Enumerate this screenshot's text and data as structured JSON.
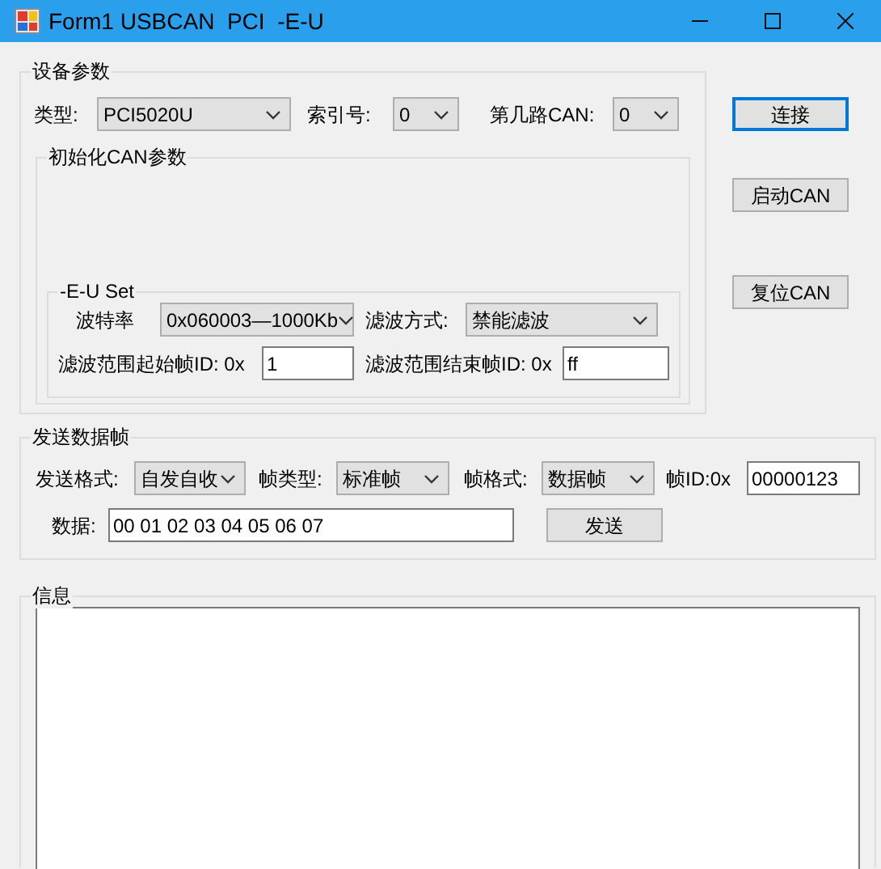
{
  "window": {
    "title": "Form1 USBCAN  PCI  -E-U"
  },
  "device_params": {
    "title": "设备参数",
    "fields": [
      {
        "label": "类型:",
        "value": "PCI5020U"
      },
      {
        "label": "索引号:",
        "value": "0"
      },
      {
        "label": "第几路CAN:",
        "value": "0"
      }
    ],
    "init_group": {
      "title": "初始化CAN参数",
      "eu_set": {
        "title": "-E-U Set",
        "row_1": [
          {
            "kind": "combo",
            "label": "波特率",
            "value": "0x060003—1000Kb"
          },
          {
            "kind": "combo",
            "label": "滤波方式:",
            "value": "禁能滤波"
          }
        ],
        "row_2": [
          {
            "kind": "input",
            "label": "滤波范围起始帧ID: 0x",
            "value": "1"
          },
          {
            "kind": "input",
            "label": "滤波范围结束帧ID: 0x",
            "value": "ff"
          }
        ]
      }
    }
  },
  "side_buttons": [
    {
      "label": "连接",
      "focused": true
    },
    {
      "label": "启动CAN",
      "focused": false
    },
    {
      "label": "复位CAN",
      "focused": false
    }
  ],
  "send_frame": {
    "title": "发送数据帧",
    "row_1": [
      {
        "kind": "combo",
        "label": "发送格式:",
        "value": "自发自收"
      },
      {
        "kind": "combo",
        "label": "帧类型:",
        "value": "标准帧"
      },
      {
        "kind": "combo",
        "label": "帧格式:",
        "value": "数据帧"
      },
      {
        "kind": "input",
        "label": "帧ID:0x",
        "value": "00000123"
      }
    ],
    "data": {
      "label": "数据:",
      "value": "00 01 02 03 04 05 06 07"
    },
    "send_button": "发送"
  },
  "info": {
    "title": "信息"
  }
}
